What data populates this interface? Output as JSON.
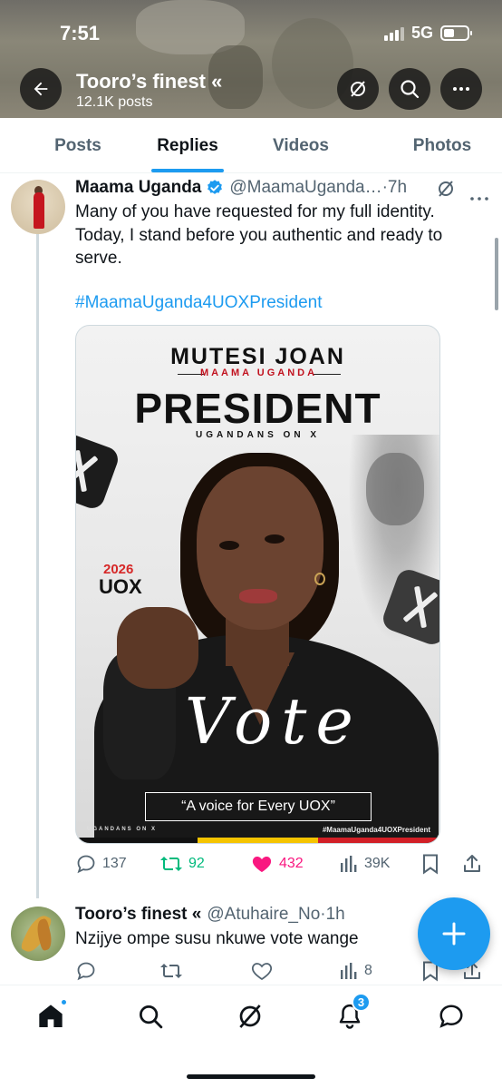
{
  "status_bar": {
    "time": "7:51",
    "network": "5G"
  },
  "header": {
    "title": "Tooro’s finest «",
    "subtitle": "12.1K posts"
  },
  "tabs": [
    {
      "label": "Posts",
      "active": false
    },
    {
      "label": "Replies",
      "active": true
    },
    {
      "label": "Videos",
      "active": false
    },
    {
      "label": "Photos",
      "active": false
    }
  ],
  "tweet1": {
    "author": "Maama Uganda",
    "handle": "@MaamaUganda…",
    "time": "·7h",
    "text": "Many of you have requested for my full identity. Today, I stand before you authentic and ready to serve.",
    "hashtag": "#MaamaUganda4UOXPresident",
    "poster": {
      "name": "MUTESI JOAN",
      "nickname": "MAAMA UGANDA",
      "role": "PRESIDENT",
      "group": "UGANDANS ON X",
      "year": "2026",
      "uox": "UOX",
      "vote": "Vote",
      "tagline": "“A voice for Every UOX”",
      "footer_left": "UGANDANS ON X",
      "footer_right": "#MaamaUganda4UOXPresident",
      "stripe_colors": [
        "#111111",
        "#f5c400",
        "#d21f26"
      ]
    },
    "stats": {
      "replies": "137",
      "retweets": "92",
      "likes": "432",
      "views": "39K"
    }
  },
  "tweet2": {
    "author": "Tooro’s finest «",
    "handle": "@Atuhaire_No",
    "time": "·1h",
    "text": "Nzijye ompe susu nkuwe vote wange",
    "stats": {
      "replies": "",
      "retweets": "",
      "likes": "",
      "views": "8"
    }
  },
  "bottom_nav": {
    "notifications_count": "3"
  },
  "colors": {
    "accent": "#1d9bf0",
    "retweet": "#00ba7c",
    "like": "#f91880",
    "secondary_text": "#536471"
  }
}
